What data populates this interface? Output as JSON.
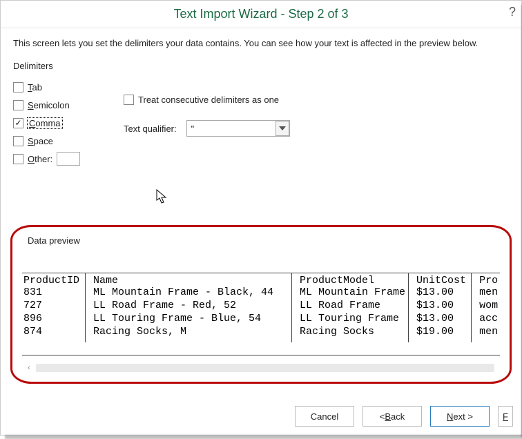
{
  "title": "Text Import Wizard - Step 2 of 3",
  "help_glyph": "?",
  "intro": "This screen lets you set the delimiters your data contains.  You can see how your text is affected in the preview below.",
  "delimiters_label": "Delimiters",
  "delims": {
    "tab": {
      "label": "Tab",
      "ul": "T",
      "rest": "ab",
      "checked": false
    },
    "semicolon": {
      "label": "Semicolon",
      "ul": "S",
      "rest": "emicolon",
      "checked": false
    },
    "comma": {
      "label": "Comma",
      "ul": "C",
      "rest": "omma",
      "checked": true
    },
    "space": {
      "label": "Space",
      "ul": "S",
      "rest": "pace",
      "checked": false
    },
    "other": {
      "label": "Other:",
      "ul": "O",
      "rest": "ther:",
      "checked": false,
      "value": ""
    }
  },
  "treat": {
    "label_pre": "T",
    "label_ul": "r",
    "label_post": "eat consecutive delimiters as one",
    "checked": false
  },
  "text_qualifier": {
    "label_pre": "Text ",
    "label_ul": "q",
    "label_post": "ualifier:",
    "value": "\""
  },
  "data_preview_label": "Data preview",
  "preview": {
    "columns": [
      "ProductID",
      "Name",
      "ProductModel",
      "UnitCost",
      "Pro"
    ],
    "rows": [
      [
        "831",
        "ML Mountain Frame - Black, 44",
        "ML Mountain Frame",
        "$13.00",
        "men"
      ],
      [
        "727",
        "LL Road Frame - Red, 52",
        "LL Road Frame",
        "$13.00",
        "wom"
      ],
      [
        "896",
        "LL Touring Frame - Blue, 54",
        "LL Touring Frame",
        "$13.00",
        "acc"
      ],
      [
        "874",
        "Racing Socks, M",
        "Racing Socks",
        "$19.00",
        "men"
      ]
    ]
  },
  "buttons": {
    "cancel": "Cancel",
    "back_pre": "< ",
    "back_ul": "B",
    "back_post": "ack",
    "next_ul": "N",
    "next_post": "ext >",
    "finish_ul": "F"
  }
}
